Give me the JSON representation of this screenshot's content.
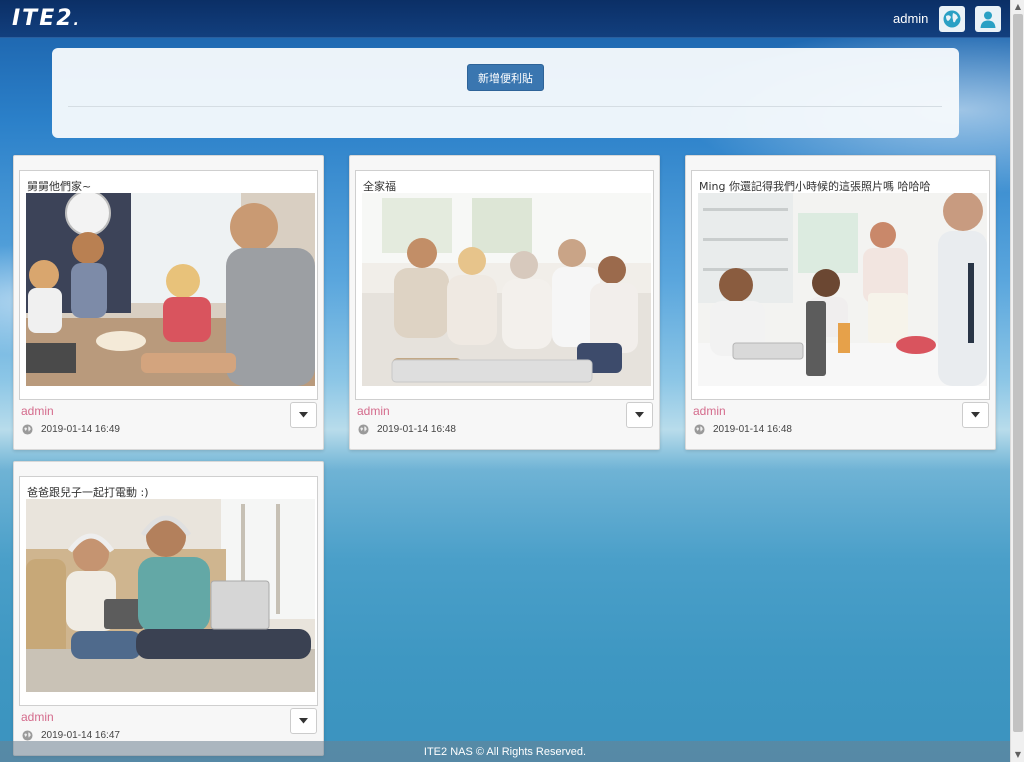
{
  "header": {
    "logo_text": "ITE2",
    "logo_mark": ".",
    "username": "admin",
    "icons": [
      "globe-icon",
      "user-icon"
    ]
  },
  "add_panel": {
    "button_label": "新增便利貼"
  },
  "notes": [
    {
      "text": "舅舅他們家~",
      "author": "admin",
      "time": "2019-01-14 16:49",
      "photo": "family-at-kitchen-table"
    },
    {
      "text": "全家福",
      "author": "admin",
      "time": "2019-01-14 16:48",
      "photo": "family-on-sofa-portrait"
    },
    {
      "text": "Ming 你還記得我們小時候的這張照片嗎 哈哈哈",
      "author": "admin",
      "time": "2019-01-14 16:48",
      "photo": "family-breakfast-kitchen"
    },
    {
      "text": "爸爸跟兒子一起打電動 :)",
      "author": "admin",
      "time": "2019-01-14 16:47",
      "photo": "father-son-gaming-headphones"
    }
  ],
  "footer": {
    "text": "ITE2 NAS © All Rights Reserved."
  },
  "colors": {
    "accent": "#3a76b0",
    "author": "#d46b8c",
    "header_bg": "#0b2f66"
  }
}
